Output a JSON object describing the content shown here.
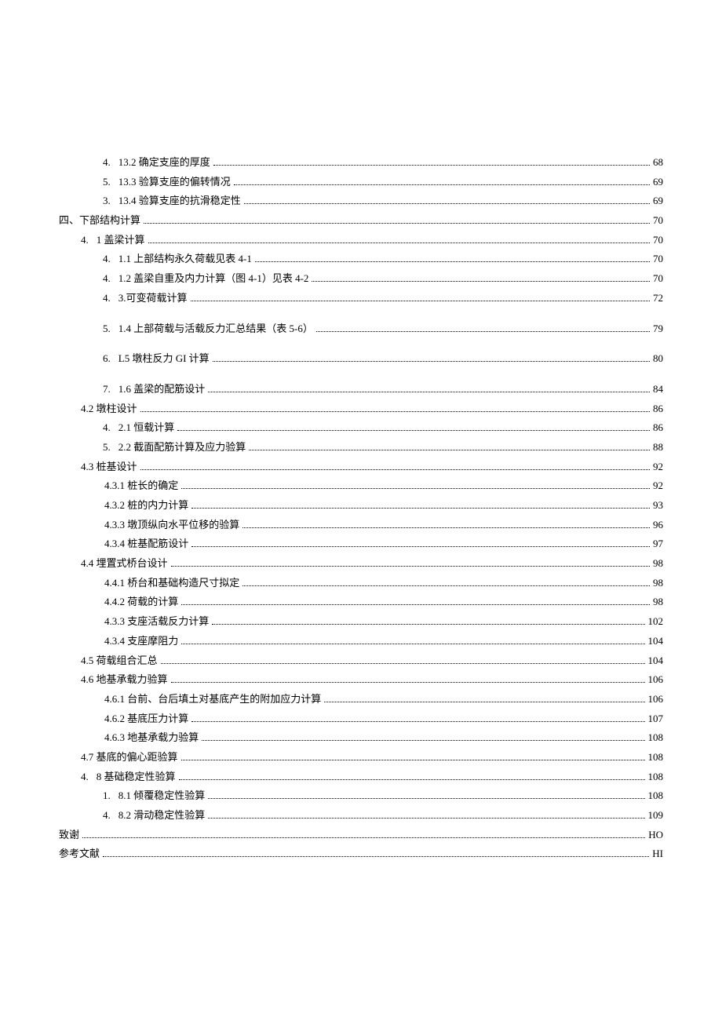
{
  "toc": [
    {
      "indent": "indent-2",
      "num": "4.",
      "label": "13.2 确定支座的厚度",
      "page": "68",
      "gap": false
    },
    {
      "indent": "indent-2",
      "num": "5.",
      "label": "13.3 验算支座的偏转情况",
      "page": "69",
      "gap": false
    },
    {
      "indent": "indent-2",
      "num": "3.",
      "label": "13.4 验算支座的抗滑稳定性",
      "page": "69",
      "gap": false
    },
    {
      "indent": "indent-0",
      "num": "",
      "label": "四、下部结构计算",
      "page": "70",
      "gap": false
    },
    {
      "indent": "indent-1",
      "num": "4.",
      "label": "1 盖梁计算",
      "page": "70",
      "gap": false
    },
    {
      "indent": "indent-2",
      "num": "4.",
      "label": "1.1 上部结构永久荷载见表 4-1",
      "page": "70",
      "gap": false,
      "alt": true
    },
    {
      "indent": "indent-2",
      "num": "4.",
      "label": "1.2 盖梁自重及内力计算（图 4-1）见表 4-2",
      "page": "70",
      "gap": false,
      "alt": true
    },
    {
      "indent": "indent-2",
      "num": "4.",
      "label": "3.可变荷载计算",
      "page": "72",
      "gap": false
    },
    {
      "indent": "indent-2",
      "num": "5.",
      "label": "1.4 上部荷载与活载反力汇总结果（表 5-6）",
      "page": "79",
      "gap": true,
      "alt": true
    },
    {
      "indent": "indent-2",
      "num": "6.",
      "label": "L5 墩柱反力 GI 计算",
      "page": "80",
      "gap": true
    },
    {
      "indent": "indent-2",
      "num": "7.",
      "label": "1.6 盖梁的配筋设计",
      "page": "84",
      "gap": true
    },
    {
      "indent": "indent-1",
      "num": "",
      "label": "4.2 墩柱设计",
      "page": "86",
      "gap": false
    },
    {
      "indent": "indent-2",
      "num": "4.",
      "label": "2.1 恒载计算",
      "page": "86",
      "gap": false
    },
    {
      "indent": "indent-2",
      "num": "5.",
      "label": "2.2 截面配筋计算及应力验算",
      "page": "88",
      "gap": false
    },
    {
      "indent": "indent-1",
      "num": "",
      "label": "4.3 桩基设计",
      "page": "92",
      "gap": false
    },
    {
      "indent": "indent-2b",
      "num": "",
      "label": "4.3.1 桩长的确定",
      "page": "92",
      "gap": false
    },
    {
      "indent": "indent-2b",
      "num": "",
      "label": "4.3.2 桩的内力计算",
      "page": "93",
      "gap": false
    },
    {
      "indent": "indent-2b",
      "num": "",
      "label": "4.3.3 墩顶纵向水平位移的验算",
      "page": "96",
      "gap": false
    },
    {
      "indent": "indent-2b",
      "num": "",
      "label": "4.3.4 桩基配筋设计",
      "page": "97",
      "gap": false
    },
    {
      "indent": "indent-1",
      "num": "",
      "label": "4.4 埋置式桥台设计",
      "page": "98",
      "gap": false
    },
    {
      "indent": "indent-2b",
      "num": "",
      "label": "4.4.1 桥台和基础构造尺寸拟定",
      "page": "98",
      "gap": false
    },
    {
      "indent": "indent-2b",
      "num": "",
      "label": "4.4.2 荷载的计算",
      "page": "98",
      "gap": false
    },
    {
      "indent": "indent-2b",
      "num": "",
      "label": "4.3.3 支座活载反力计算",
      "page": "102",
      "gap": false
    },
    {
      "indent": "indent-2b",
      "num": "",
      "label": "4.3.4 支座摩阻力",
      "page": "104",
      "gap": false
    },
    {
      "indent": "indent-1",
      "num": "",
      "label": "4.5 荷载组合汇总",
      "page": "104",
      "gap": false
    },
    {
      "indent": "indent-1",
      "num": "",
      "label": "4.6 地基承载力验算",
      "page": "106",
      "gap": false
    },
    {
      "indent": "indent-2b",
      "num": "",
      "label": "4.6.1 台前、台后填土对基底产生的附加应力计算",
      "page": "106",
      "gap": false
    },
    {
      "indent": "indent-2b",
      "num": "",
      "label": "4.6.2 基底压力计算",
      "page": "107",
      "gap": false
    },
    {
      "indent": "indent-2b",
      "num": "",
      "label": "4.6.3 地基承载力验算",
      "page": "108",
      "gap": false
    },
    {
      "indent": "indent-1",
      "num": "",
      "label": "4.7 基底的偏心距验算",
      "page": "108",
      "gap": false
    },
    {
      "indent": "indent-1",
      "num": "4.",
      "label": "8 基础稳定性验算",
      "page": "108",
      "gap": false
    },
    {
      "indent": "indent-2",
      "num": "1.",
      "label": "8.1 倾覆稳定性验算",
      "page": "108",
      "gap": false
    },
    {
      "indent": "indent-2",
      "num": "4.",
      "label": "8.2 滑动稳定性验算",
      "page": "109",
      "gap": false
    },
    {
      "indent": "indent-0",
      "num": "",
      "label": "致谢",
      "page": "HO",
      "gap": false
    },
    {
      "indent": "indent-0",
      "num": "",
      "label": "参考文献",
      "page": "HI",
      "gap": false
    }
  ]
}
